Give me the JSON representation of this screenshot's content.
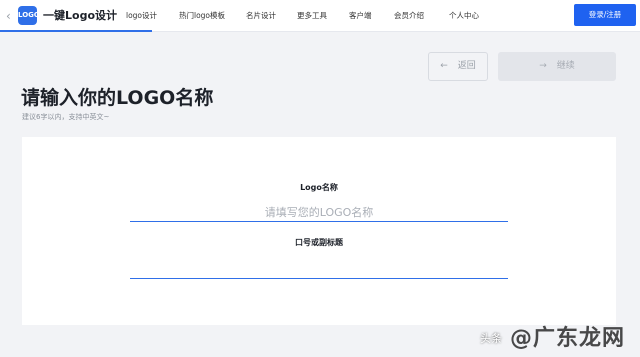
{
  "header": {
    "logo_text": "LOGO",
    "brand": "一键Logo设计",
    "nav": [
      "logo设计",
      "热门logo模板",
      "名片设计",
      "更多工具",
      "客户端",
      "会员介绍",
      "个人中心"
    ],
    "login": "登录/注册",
    "back_icon": "chevron-left-icon"
  },
  "steps": {
    "back_label": "返回",
    "back_icon": "←",
    "next_label": "继续",
    "next_icon": "→"
  },
  "page": {
    "title": "请输入你的LOGO名称",
    "subtitle": "建议6字以内，支持中英文~"
  },
  "form": {
    "name_label": "Logo名称",
    "name_placeholder": "请填写您的LOGO名称",
    "slogan_label": "口号或副标题",
    "slogan_placeholder": ""
  },
  "watermark": {
    "prefix": "头条",
    "main": "@广东龙网"
  },
  "colors": {
    "accent": "#2f6fe8",
    "login_bg": "#1f62f0",
    "page_bg": "#f2f3f6"
  }
}
